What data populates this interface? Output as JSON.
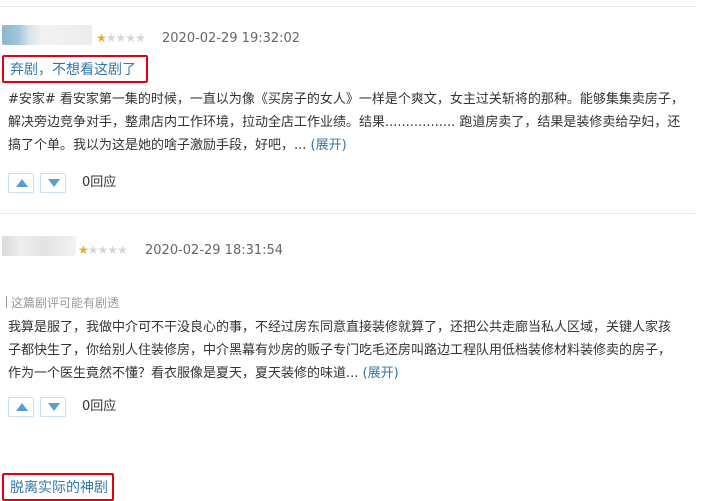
{
  "reviews": [
    {
      "rating": 1,
      "max_rating": 5,
      "date": "2020-02-29 19:32:02",
      "title": "弃剧，不想看这剧了",
      "spoiler_note": "",
      "body_lines": [
        "#安家# 看安家第一集的时候，一直以为像《买房子的女人》一样是个爽文，女主过关斩将的那种。能够集集卖房子，",
        "解决旁边竞争对手，整肃店内工作环境，拉动全店工作业绩。结果................. 跑道房卖了，结果是装修卖给孕妇，还",
        "搞了个单。我以为这是她的啥子激励手段，好吧，..."
      ],
      "expand_label": "(展开)",
      "reply_label": "0回应"
    },
    {
      "rating": 1,
      "max_rating": 5,
      "date": "2020-02-29 18:31:54",
      "title": "脱离实际的神剧",
      "spoiler_note": "这篇剧评可能有剧透",
      "body_lines": [
        "我算是服了，我做中介可不干没良心的事，不经过房东同意直接装修就算了，还把公共走廊当私人区域，关键人家孩",
        "子都快生了，你给别人住装修房，中介黑幕有炒房的贩子专门吃毛还房叫路边工程队用低档装修材料装修卖的房子，",
        "作为一个医生竟然不懂？看衣服像是夏天，夏天装修的味道..."
      ],
      "expand_label": "(展开)",
      "reply_label": "0回应"
    }
  ],
  "colors": {
    "link": "#3377aa",
    "highlight_box": "#e60012",
    "star_on": "#f5a623",
    "star_off": "#d6d6d6",
    "vote_border": "#c9dff2"
  },
  "icons": {
    "avatar": "blurred-avatar",
    "star": "star-icon",
    "vote_up": "triangle-up-icon",
    "vote_down": "triangle-down-icon"
  }
}
